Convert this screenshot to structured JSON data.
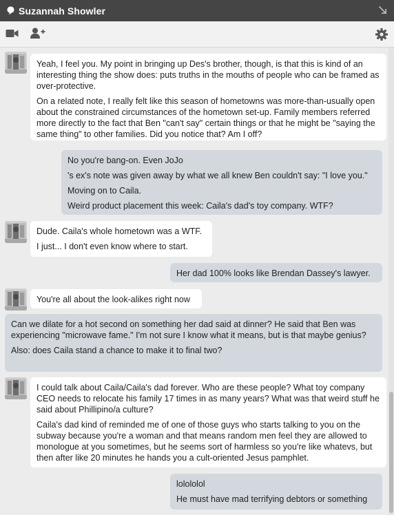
{
  "window": {
    "title": "Suzannah Showler"
  },
  "toolbar": {
    "icons": [
      "video-camera-icon",
      "add-user-icon",
      "gear-icon"
    ]
  },
  "messages": [
    {
      "direction": "in",
      "paragraphs": [
        "Yeah, I feel you. My point in bringing up Des's brother, though, is that this is kind of an interesting thing the show does: puts truths in the mouths of people who can be framed as over-protective.",
        "On a related note, I really felt like this season of hometowns was more-than-usually open about the constrained circumstances of the hometown set-up. Family members referred more directly to the fact that Ben \"can't say\" certain things or that he might be \"saying the same thing\" to other families. Did you notice that? Am I off?"
      ]
    },
    {
      "direction": "out",
      "paragraphs": [
        "No you're bang-on. Even JoJo",
        "'s ex's note was given away by what we all knew Ben couldn't say: \"I love you.\"",
        "Moving on to Caila.",
        "Weird product placement this week: Caila's dad's toy company. WTF?"
      ]
    },
    {
      "direction": "in",
      "paragraphs": [
        "Dude. Caila's whole hometown was a WTF.",
        "I just... I don't even know where to start."
      ]
    },
    {
      "direction": "out",
      "paragraphs": [
        "Her dad 100% looks like Brendan Dassey's lawyer."
      ]
    },
    {
      "direction": "in",
      "paragraphs": [
        "You're all about the look-alikes right now"
      ]
    },
    {
      "direction": "out",
      "paragraphs": [
        "Can we dilate for a hot second on something her dad said at dinner? He said that Ben was experiencing \"microwave fame.\" I'm not sure I know what it means, but is that maybe genius?",
        "Also: does Caila stand a chance to make it to final two?"
      ]
    },
    {
      "direction": "in",
      "paragraphs": [
        "I could talk about Caila/Caila's dad forever. Who are these people? What toy company CEO needs to relocate his family 17 times in as many years? What was that weird stuff he said about Phillipino/a culture?",
        "Caila's dad kind of reminded me of one of those guys who starts talking to you on the subway because you're a woman and that means random men feel they are allowed to monologue at you sometimes, but he seems sort of harmless so you're like whatevs, but then after like 20 minutes he hands you a cult-oriented Jesus pamphlet."
      ]
    },
    {
      "direction": "out",
      "paragraphs": [
        "lolololol",
        "He must have mad terrifying debtors or something"
      ]
    }
  ]
}
